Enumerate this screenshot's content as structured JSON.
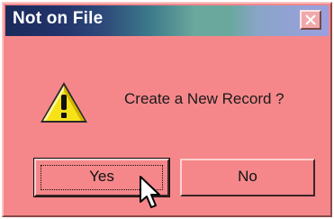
{
  "window": {
    "title": "Not on File"
  },
  "dialog": {
    "message": "Create a New Record ?",
    "icon": "warning-icon"
  },
  "buttons": {
    "yes_label": "Yes",
    "no_label": "No"
  },
  "colors": {
    "dialog_bg": "#f5878a",
    "title_text": "#ffffff"
  }
}
